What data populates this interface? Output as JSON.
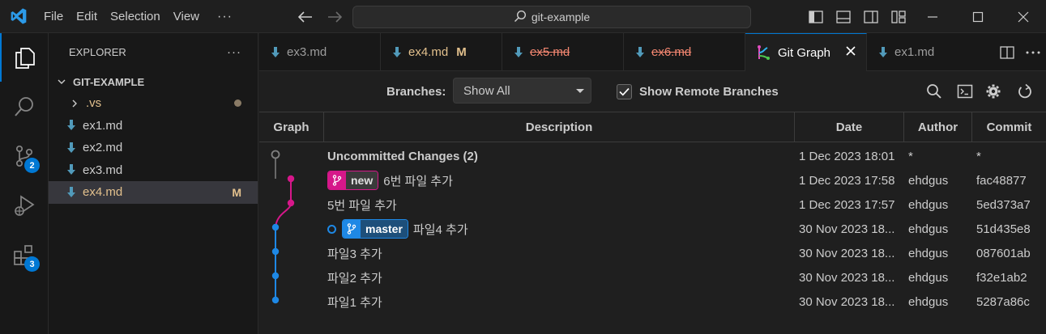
{
  "menu": {
    "items": [
      "File",
      "Edit",
      "Selection",
      "View"
    ],
    "more": "···"
  },
  "search": {
    "text": "git-example"
  },
  "explorer": {
    "title": "EXPLORER",
    "more": "···",
    "root": "GIT-EXAMPLE",
    "items": [
      {
        "label": ".vs",
        "type": "folder",
        "status": "dot"
      },
      {
        "label": "ex1.md",
        "type": "file",
        "status": ""
      },
      {
        "label": "ex2.md",
        "type": "file",
        "status": ""
      },
      {
        "label": "ex3.md",
        "type": "file",
        "status": ""
      },
      {
        "label": "ex4.md",
        "type": "file",
        "status": "M"
      }
    ]
  },
  "activity": {
    "scm_badge": "2",
    "extensions_badge": "3"
  },
  "tabs": [
    {
      "label": "ex3.md",
      "state": "normal"
    },
    {
      "label": "ex4.md",
      "state": "modified",
      "mod": "M"
    },
    {
      "label": "ex5.md",
      "state": "deleted"
    },
    {
      "label": "ex6.md",
      "state": "deleted"
    },
    {
      "label": "Git Graph",
      "state": "active"
    },
    {
      "label": "ex1.md",
      "state": "normal"
    }
  ],
  "gitgraph": {
    "branches_label": "Branches:",
    "branches_value": "Show All",
    "show_remote_label": "Show Remote Branches",
    "show_remote_checked": true,
    "columns": [
      "Graph",
      "Description",
      "Date",
      "Author",
      "Commit"
    ],
    "rows": [
      {
        "description": "Uncommitted Changes (2)",
        "date": "1 Dec 2023 18:01",
        "author": "*",
        "commit": "*"
      },
      {
        "ref": "new",
        "description": "6번 파일 추가",
        "date": "1 Dec 2023 17:58",
        "author": "ehdgus",
        "commit": "fac48877"
      },
      {
        "description": "5번 파일 추가",
        "date": "1 Dec 2023 17:57",
        "author": "ehdgus",
        "commit": "5ed373a7"
      },
      {
        "ref": "master",
        "description": "파일4 추가",
        "date": "30 Nov 2023 18...",
        "author": "ehdgus",
        "commit": "51d435e8"
      },
      {
        "description": "파일3 추가",
        "date": "30 Nov 2023 18...",
        "author": "ehdgus",
        "commit": "087601ab"
      },
      {
        "description": "파일2 추가",
        "date": "30 Nov 2023 18...",
        "author": "ehdgus",
        "commit": "f32e1ab2"
      },
      {
        "description": "파일1 추가",
        "date": "30 Nov 2023 18...",
        "author": "ehdgus",
        "commit": "5287a86c"
      }
    ]
  },
  "colors": {
    "accent": "#0078d4",
    "branch_new": "#d6178a",
    "branch_master": "#1e88e5",
    "modified": "#e2c08d",
    "deleted": "#f48771"
  }
}
